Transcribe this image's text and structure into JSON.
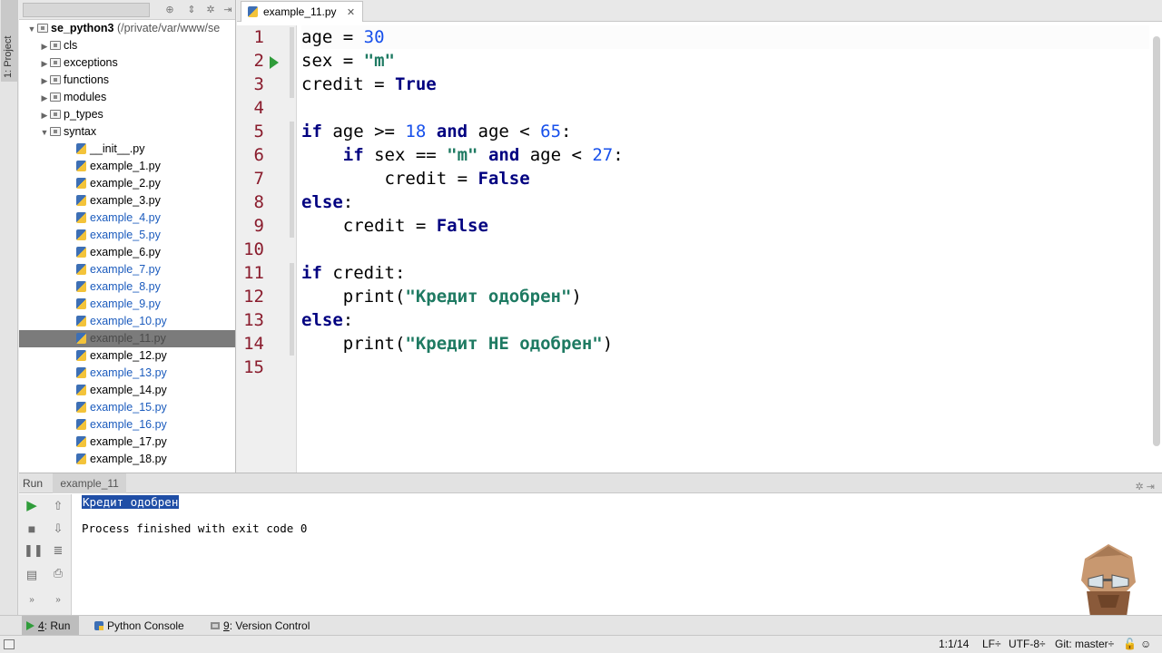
{
  "sidebar_tab": "1: Project",
  "project": {
    "root_name": "se_python3",
    "root_path": "(/private/var/www/se",
    "folders": [
      {
        "label": "cls",
        "expanded": false
      },
      {
        "label": "exceptions",
        "expanded": false
      },
      {
        "label": "functions",
        "expanded": false
      },
      {
        "label": "modules",
        "expanded": false
      },
      {
        "label": "p_types",
        "expanded": false
      },
      {
        "label": "syntax",
        "expanded": true
      }
    ],
    "files": [
      {
        "label": "__init__.py",
        "vcs": false
      },
      {
        "label": "example_1.py",
        "vcs": false
      },
      {
        "label": "example_2.py",
        "vcs": false
      },
      {
        "label": "example_3.py",
        "vcs": false
      },
      {
        "label": "example_4.py",
        "vcs": true
      },
      {
        "label": "example_5.py",
        "vcs": true
      },
      {
        "label": "example_6.py",
        "vcs": false
      },
      {
        "label": "example_7.py",
        "vcs": true
      },
      {
        "label": "example_8.py",
        "vcs": true
      },
      {
        "label": "example_9.py",
        "vcs": true
      },
      {
        "label": "example_10.py",
        "vcs": true
      },
      {
        "label": "example_11.py",
        "vcs": false,
        "selected": true
      },
      {
        "label": "example_12.py",
        "vcs": false
      },
      {
        "label": "example_13.py",
        "vcs": true
      },
      {
        "label": "example_14.py",
        "vcs": false
      },
      {
        "label": "example_15.py",
        "vcs": true
      },
      {
        "label": "example_16.py",
        "vcs": true
      },
      {
        "label": "example_17.py",
        "vcs": false
      },
      {
        "label": "example_18.py",
        "vcs": false
      }
    ]
  },
  "editor": {
    "tab_label": "example_11.py",
    "line_numbers": [
      "1",
      "2",
      "3",
      "4",
      "5",
      "6",
      "7",
      "8",
      "9",
      "10",
      "11",
      "12",
      "13",
      "14",
      "15"
    ],
    "code_lines": [
      [
        {
          "t": "age = "
        },
        {
          "t": "30",
          "c": "num"
        }
      ],
      [
        {
          "t": "sex = "
        },
        {
          "t": "\"m\"",
          "c": "str"
        }
      ],
      [
        {
          "t": "credit = "
        },
        {
          "t": "True",
          "c": "kw"
        }
      ],
      [],
      [
        {
          "t": "if",
          "c": "kw"
        },
        {
          "t": " age >= "
        },
        {
          "t": "18",
          "c": "num"
        },
        {
          "t": " "
        },
        {
          "t": "and",
          "c": "kw"
        },
        {
          "t": " age < "
        },
        {
          "t": "65",
          "c": "num"
        },
        {
          "t": ":"
        }
      ],
      [
        {
          "t": "    "
        },
        {
          "t": "if",
          "c": "kw"
        },
        {
          "t": " sex == "
        },
        {
          "t": "\"m\"",
          "c": "str"
        },
        {
          "t": " "
        },
        {
          "t": "and",
          "c": "kw"
        },
        {
          "t": " age < "
        },
        {
          "t": "27",
          "c": "num"
        },
        {
          "t": ":"
        }
      ],
      [
        {
          "t": "        credit = "
        },
        {
          "t": "False",
          "c": "kw"
        }
      ],
      [
        {
          "t": "else",
          "c": "kw"
        },
        {
          "t": ":"
        }
      ],
      [
        {
          "t": "    credit = "
        },
        {
          "t": "False",
          "c": "kw"
        }
      ],
      [],
      [
        {
          "t": "if",
          "c": "kw"
        },
        {
          "t": " credit:"
        }
      ],
      [
        {
          "t": "    print("
        },
        {
          "t": "\"Кредит одобрен\"",
          "c": "str"
        },
        {
          "t": ")"
        }
      ],
      [
        {
          "t": "else",
          "c": "kw"
        },
        {
          "t": ":"
        }
      ],
      [
        {
          "t": "    print("
        },
        {
          "t": "\"Кредит НЕ одобрен\"",
          "c": "str"
        },
        {
          "t": ")"
        }
      ],
      []
    ]
  },
  "run": {
    "header_label": "Run",
    "config_name": "example_11",
    "output_line": "Кредит одобрен",
    "exit_message": "Process finished with exit code 0"
  },
  "bottom_tabs": [
    {
      "num": "4",
      "label": ": Run",
      "active": true,
      "icon": "run-icon"
    },
    {
      "num": "",
      "label": "Python Console",
      "active": false,
      "icon": "python-console-icon"
    },
    {
      "num": "9",
      "label": ": Version Control",
      "active": false,
      "icon": "version-control-icon"
    }
  ],
  "status": {
    "position": "1:1/14",
    "line_sep": "LF÷",
    "encoding": "UTF-8÷",
    "git": "Git: master÷"
  },
  "colors": {
    "keyword": "#000080",
    "number": "#1750eb",
    "string": "#1e7a62",
    "line_number": "#8a1c2d",
    "vcs_modified": "#1b5bbd"
  }
}
